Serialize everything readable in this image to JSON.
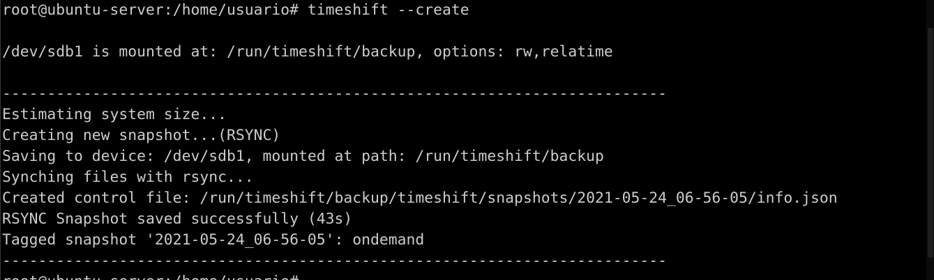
{
  "terminal": {
    "lines": [
      "root@ubuntu-server:/home/usuario# timeshift --create",
      "",
      "/dev/sdb1 is mounted at: /run/timeshift/backup, options: rw,relatime",
      "",
      "--------------------------------------------------------------------------",
      "Estimating system size...",
      "Creating new snapshot...(RSYNC)",
      "Saving to device: /dev/sdb1, mounted at path: /run/timeshift/backup",
      "Synching files with rsync...",
      "Created control file: /run/timeshift/backup/timeshift/snapshots/2021-05-24_06-56-05/info.json",
      "RSYNC Snapshot saved successfully (43s)",
      "Tagged snapshot '2021-05-24_06-56-05': ondemand",
      "--------------------------------------------------------------------------",
      "root@ubuntu-server:/home/usuario#"
    ]
  },
  "colors": {
    "background": "#000000",
    "foreground": "#cccccc"
  }
}
